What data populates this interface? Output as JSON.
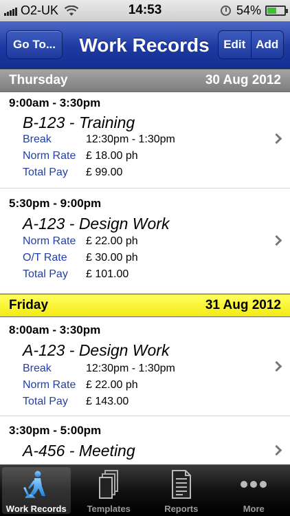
{
  "status_bar": {
    "carrier": "O2-UK",
    "time": "14:53",
    "battery": "54%",
    "battery_level": 0.54
  },
  "nav": {
    "left_button": "Go To...",
    "title": "Work Records",
    "edit": "Edit",
    "add": "Add"
  },
  "days": [
    {
      "day": "Thursday",
      "date": "30 Aug 2012",
      "entries": [
        {
          "time": "9:00am - 3:30pm",
          "title": "B-123 - Training",
          "rows": [
            {
              "label": "Break",
              "value": "12:30pm - 1:30pm"
            },
            {
              "label": "Norm Rate",
              "value": "£ 18.00 ph"
            },
            {
              "label": "Total Pay",
              "value": "£ 99.00"
            }
          ]
        },
        {
          "time": "5:30pm - 9:00pm",
          "title": "A-123 - Design Work",
          "rows": [
            {
              "label": "Norm Rate",
              "value": "£ 22.00 ph"
            },
            {
              "label": "O/T Rate",
              "value": "£ 30.00 ph"
            },
            {
              "label": "Total Pay",
              "value": "£ 101.00"
            }
          ]
        }
      ]
    },
    {
      "day": "Friday",
      "date": "31 Aug 2012",
      "entries": [
        {
          "time": "8:00am - 3:30pm",
          "title": "A-123 - Design Work",
          "rows": [
            {
              "label": "Break",
              "value": "12:30pm - 1:30pm"
            },
            {
              "label": "Norm Rate",
              "value": "£ 22.00 ph"
            },
            {
              "label": "Total Pay",
              "value": "£ 143.00"
            }
          ]
        },
        {
          "time": "3:30pm - 5:00pm",
          "title": "A-456 - Meeting",
          "rows": []
        }
      ]
    }
  ],
  "tabs": [
    {
      "label": "Work Records",
      "icon": "worker-icon",
      "active": true
    },
    {
      "label": "Templates",
      "icon": "templates-icon",
      "active": false
    },
    {
      "label": "Reports",
      "icon": "reports-icon",
      "active": false
    },
    {
      "label": "More",
      "icon": "more-icon",
      "active": false
    }
  ],
  "colors": {
    "nav_blue": "#1c3aa2",
    "label_blue": "#233ea2",
    "friday_header": "#f3ea14",
    "thursday_header": "#8c8c8c"
  }
}
